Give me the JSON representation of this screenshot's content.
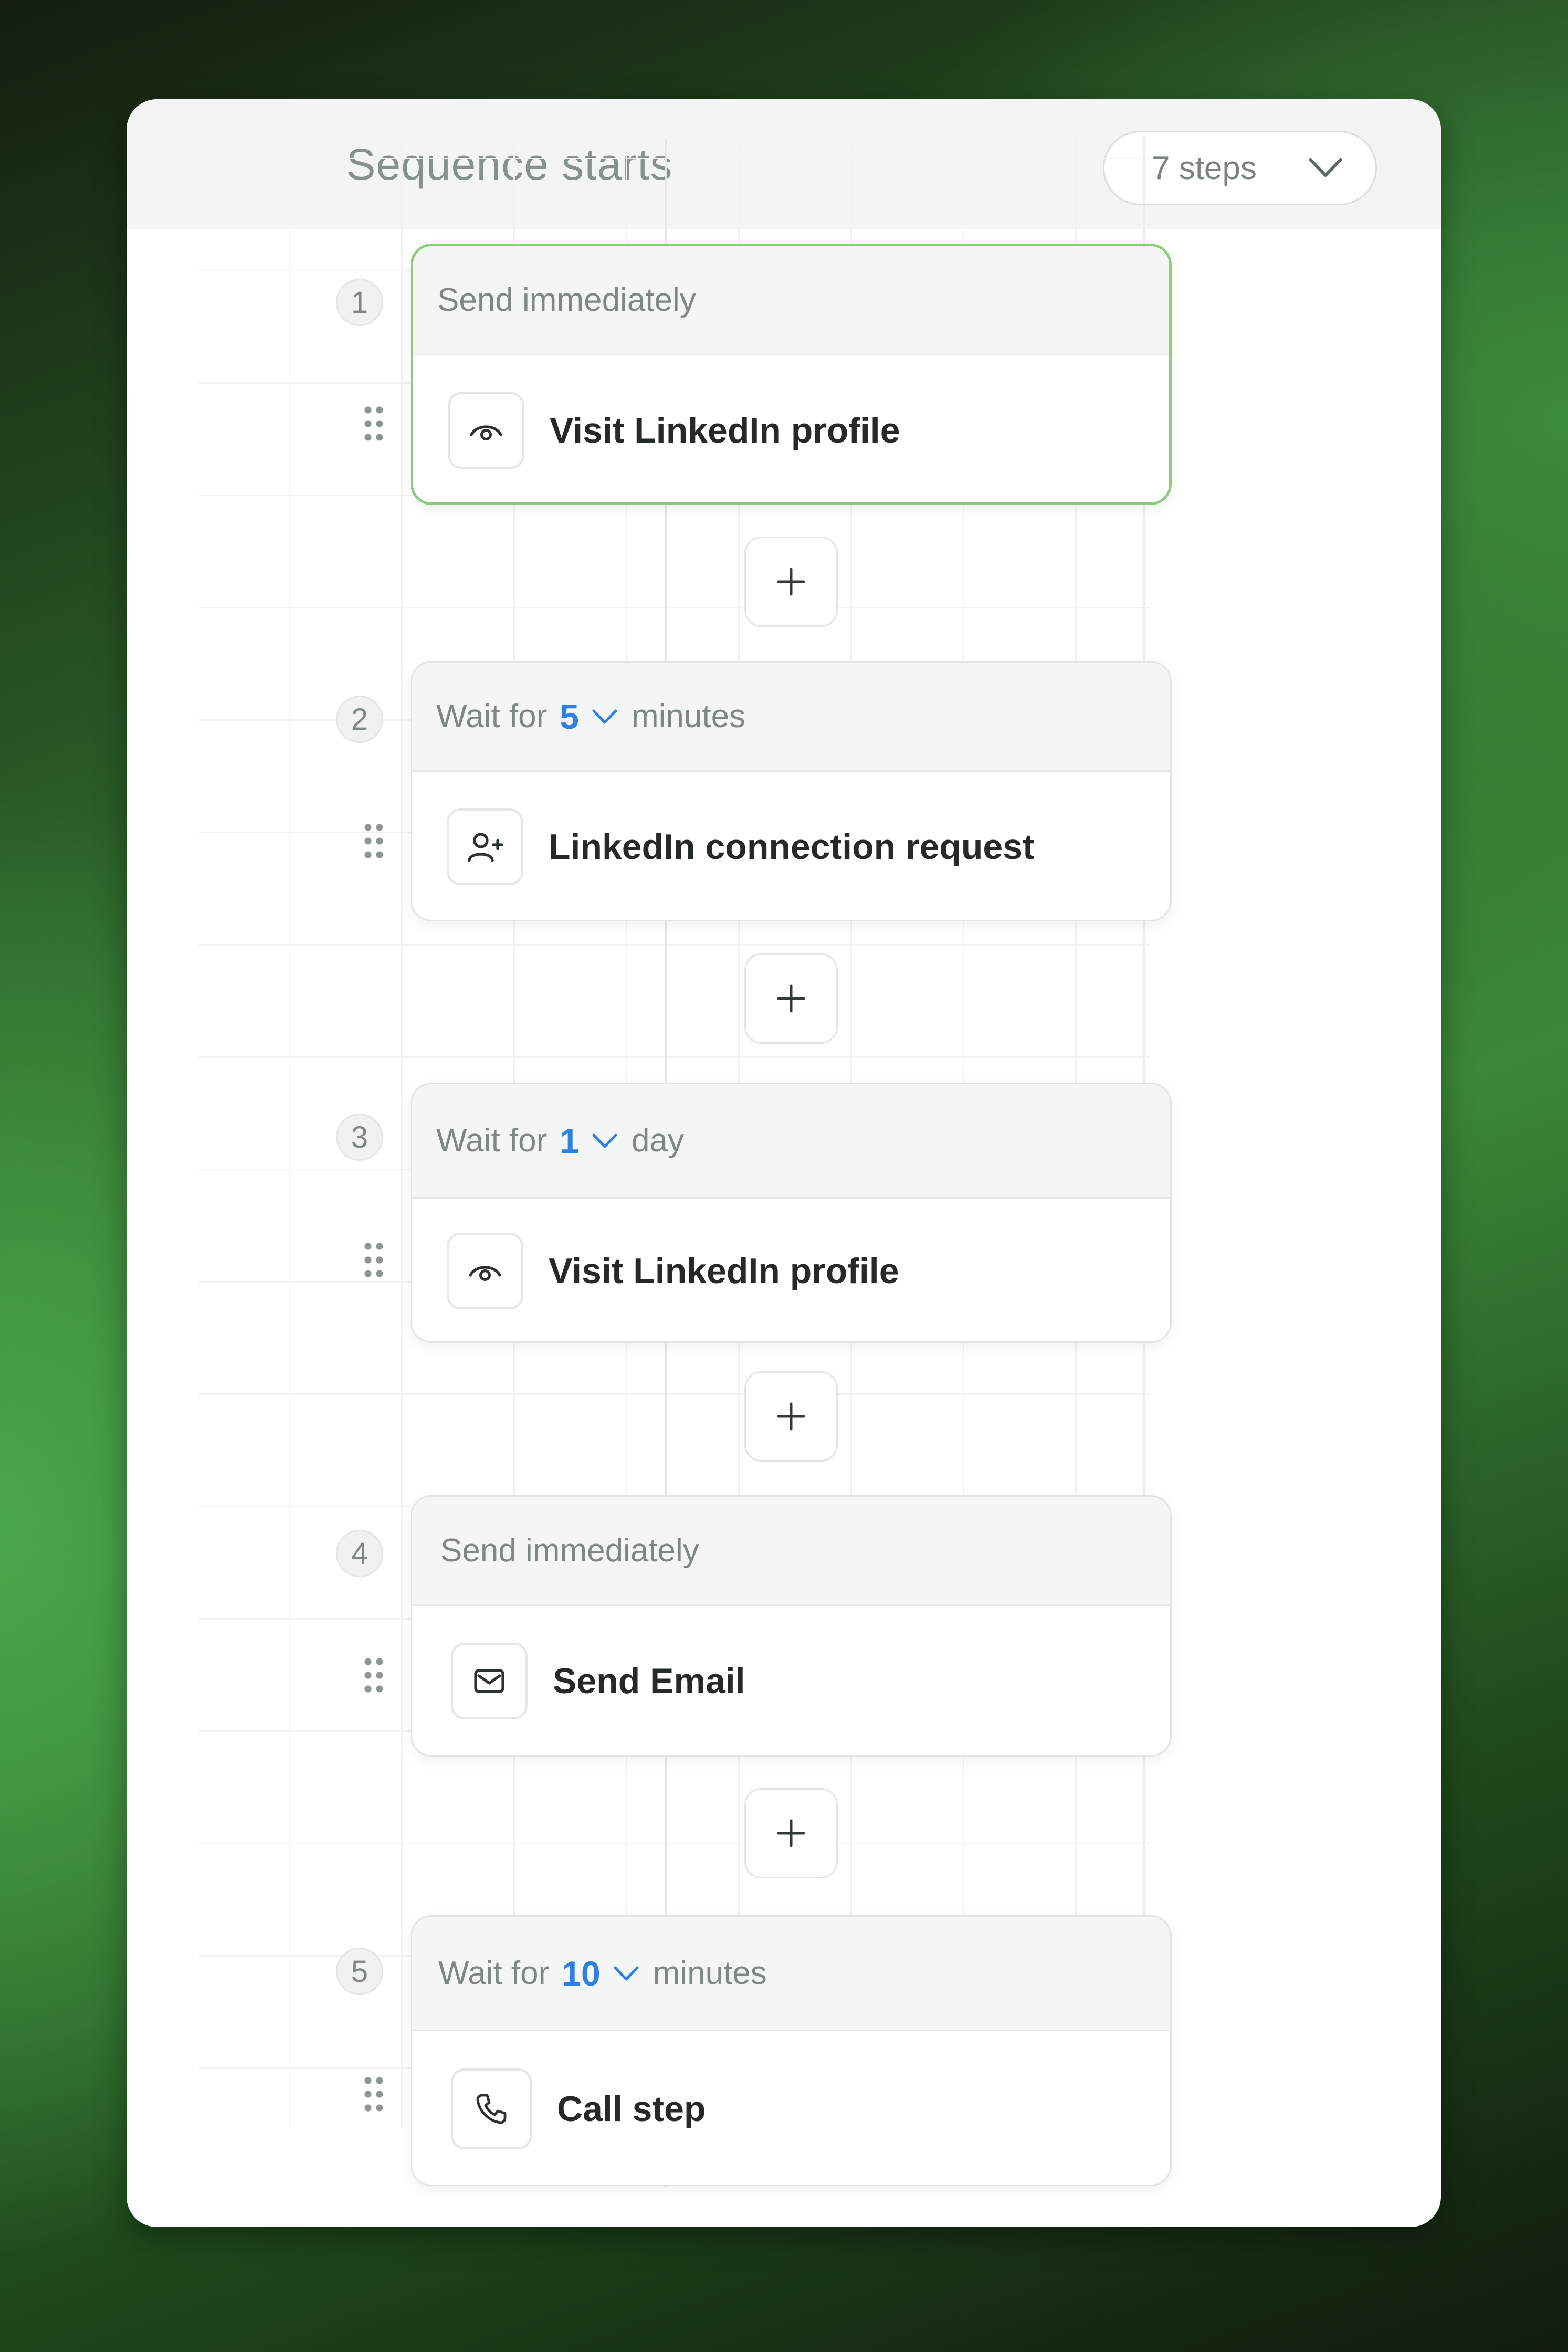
{
  "header": {
    "title": "Sequence starts",
    "steps_select": {
      "value": "7 steps",
      "icon": "chevron-down-icon"
    }
  },
  "steps": [
    {
      "number": "1",
      "timing": "Send immediately",
      "action": "Visit LinkedIn profile",
      "icon": "eye-icon",
      "active": true
    },
    {
      "number": "2",
      "timing_prefix": "Wait for",
      "timing_value": "5",
      "timing_unit": "minutes",
      "action": "LinkedIn connection request",
      "icon": "add-user-icon"
    },
    {
      "number": "3",
      "timing_prefix": "Wait for",
      "timing_value": "1",
      "timing_unit": "day",
      "action": "Visit LinkedIn profile",
      "icon": "eye-icon"
    },
    {
      "number": "4",
      "timing": "Send immediately",
      "action": "Send Email",
      "icon": "mail-icon"
    },
    {
      "number": "5",
      "timing_prefix": "Wait for",
      "timing_value": "10",
      "timing_unit": "minutes",
      "action": "Call step",
      "icon": "phone-icon"
    }
  ],
  "colors": {
    "accent_value": "#2f7fe4",
    "active_border": "#8ccc7c",
    "background_green": "#3b8838"
  }
}
